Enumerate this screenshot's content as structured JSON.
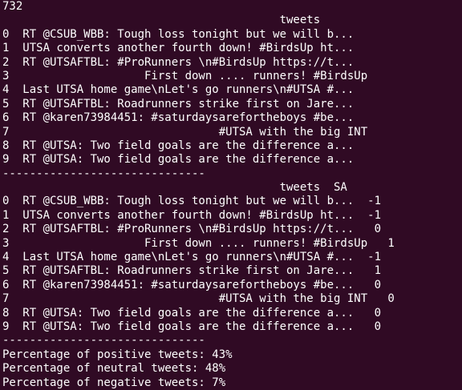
{
  "lines": [
    "732",
    "                                         tweets",
    "0  RT @CSUB_WBB: Tough loss tonight but we will b...",
    "1  UTSA converts another fourth down! #BirdsUp ht...",
    "2  RT @UTSAFTBL: #ProRunners \\n#BirdsUp https://t...",
    "3                    First down .... runners! #BirdsUp",
    "4  Last UTSA home game\\nLet's go runners\\n#UTSA #...",
    "5  RT @UTSAFTBL: Roadrunners strike first on Jare...",
    "6  RT @karen73984451: #saturdaysarefortheboys #be...",
    "7                               #UTSA with the big INT",
    "8  RT @UTSA: Two field goals are the difference a...",
    "9  RT @UTSA: Two field goals are the difference a...",
    "------------------------------",
    "                                         tweets  SA",
    "0  RT @CSUB_WBB: Tough loss tonight but we will b...  -1",
    "1  UTSA converts another fourth down! #BirdsUp ht...  -1",
    "2  RT @UTSAFTBL: #ProRunners \\n#BirdsUp https://t...   0",
    "3                    First down .... runners! #BirdsUp   1",
    "4  Last UTSA home game\\nLet's go runners\\n#UTSA #...  -1",
    "5  RT @UTSAFTBL: Roadrunners strike first on Jare...   1",
    "6  RT @karen73984451: #saturdaysarefortheboys #be...   0",
    "7                               #UTSA with the big INT   0",
    "8  RT @UTSA: Two field goals are the difference a...   0",
    "9  RT @UTSA: Two field goals are the difference a...   0",
    "------------------------------",
    "Percentage of positive tweets: 43%",
    "Percentage of neutral tweets: 48%",
    "Percentage of negative tweets: 7%"
  ]
}
